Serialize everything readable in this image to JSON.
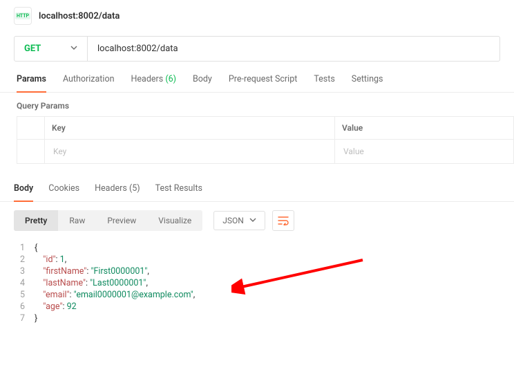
{
  "header": {
    "title": "localhost:8002/data"
  },
  "request": {
    "method": "GET",
    "url": "localhost:8002/data"
  },
  "tabs": {
    "params": "Params",
    "auth": "Authorization",
    "headers_label": "Headers",
    "headers_count": "(6)",
    "body": "Body",
    "prereq": "Pre-request Script",
    "tests": "Tests",
    "settings": "Settings"
  },
  "query_params": {
    "title": "Query Params",
    "cols": {
      "key": "Key",
      "value": "Value"
    },
    "placeholders": {
      "key": "Key",
      "value": "Value"
    }
  },
  "resp_tabs": {
    "body": "Body",
    "cookies": "Cookies",
    "headers_label": "Headers",
    "headers_count": "(5)",
    "test_results": "Test Results"
  },
  "toolbar": {
    "pretty": "Pretty",
    "raw": "Raw",
    "preview": "Preview",
    "visualize": "Visualize",
    "format": "JSON"
  },
  "json_body": {
    "id": 1,
    "firstName": "First0000001",
    "lastName": "Last0000001",
    "email": "email0000001@example.com",
    "age": 92
  }
}
